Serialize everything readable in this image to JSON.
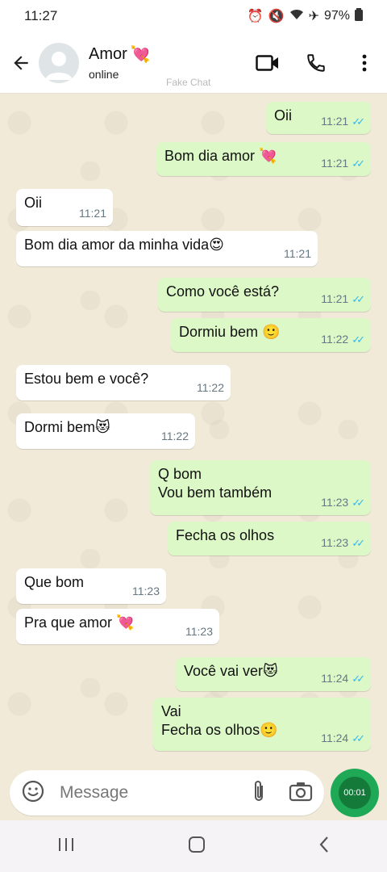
{
  "status_bar": {
    "time": "11:27",
    "battery": "97%"
  },
  "header": {
    "contact_name": "Amor",
    "contact_status": "online",
    "watermark": "Fake Chat"
  },
  "messages": [
    {
      "dir": "out",
      "text": "Oii",
      "time": "11:21",
      "read": true
    },
    {
      "dir": "out",
      "text": "Bom dia amor 💘",
      "time": "11:21",
      "read": true
    },
    {
      "dir": "in",
      "text": "Oii",
      "time": "11:21"
    },
    {
      "dir": "in",
      "text": "Bom dia amor da minha vida😍",
      "time": "11:21"
    },
    {
      "dir": "out",
      "text": "Como você está?",
      "time": "11:21",
      "read": true
    },
    {
      "dir": "out",
      "text": "Dormiu bem 🙂",
      "time": "11:22",
      "read": true
    },
    {
      "dir": "in",
      "text": "Estou bem e você?",
      "time": "11:22"
    },
    {
      "dir": "in",
      "text": "Dormi bem😻",
      "time": "11:22"
    },
    {
      "dir": "out",
      "text": "Q bom\nVou bem também",
      "time": "11:23",
      "read": true
    },
    {
      "dir": "out",
      "text": "Fecha os olhos",
      "time": "11:23",
      "read": true
    },
    {
      "dir": "in",
      "text": "Que bom",
      "time": "11:23"
    },
    {
      "dir": "in",
      "text": "Pra que amor 💘",
      "time": "11:23"
    },
    {
      "dir": "out",
      "text": "Você vai ver😻",
      "time": "11:24",
      "read": true
    },
    {
      "dir": "out",
      "text": "Vai\nFecha os olhos🙂",
      "time": "11:24",
      "read": true
    }
  ],
  "input": {
    "placeholder": "Message",
    "recording_time": "00:01"
  },
  "colors": {
    "outgoing_bubble": "#dcf8c6",
    "incoming_bubble": "#ffffff",
    "read_tick": "#34b7f1",
    "accent_green": "#1fa855"
  }
}
